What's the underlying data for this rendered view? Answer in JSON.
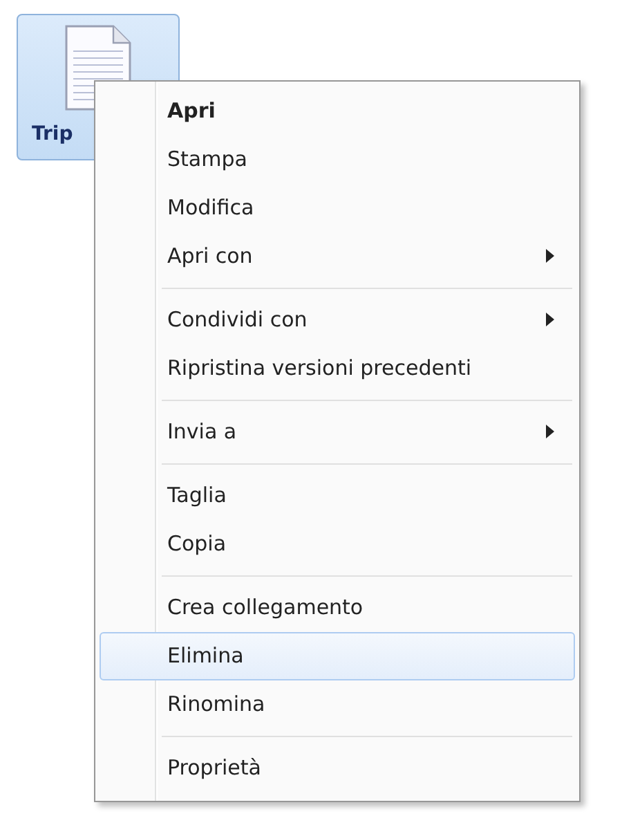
{
  "file_icon": {
    "label": "Trip",
    "selected": true
  },
  "context_menu": {
    "groups": [
      {
        "items": [
          {
            "label": "Apri",
            "default": true,
            "submenu": false,
            "selected": false
          },
          {
            "label": "Stampa",
            "default": false,
            "submenu": false,
            "selected": false
          },
          {
            "label": "Modifica",
            "default": false,
            "submenu": false,
            "selected": false
          },
          {
            "label": "Apri con",
            "default": false,
            "submenu": true,
            "selected": false
          }
        ]
      },
      {
        "items": [
          {
            "label": "Condividi con",
            "default": false,
            "submenu": true,
            "selected": false
          },
          {
            "label": "Ripristina versioni precedenti",
            "default": false,
            "submenu": false,
            "selected": false
          }
        ]
      },
      {
        "items": [
          {
            "label": "Invia a",
            "default": false,
            "submenu": true,
            "selected": false
          }
        ]
      },
      {
        "items": [
          {
            "label": "Taglia",
            "default": false,
            "submenu": false,
            "selected": false
          },
          {
            "label": "Copia",
            "default": false,
            "submenu": false,
            "selected": false
          }
        ]
      },
      {
        "items": [
          {
            "label": "Crea collegamento",
            "default": false,
            "submenu": false,
            "selected": false
          },
          {
            "label": "Elimina",
            "default": false,
            "submenu": false,
            "selected": true
          },
          {
            "label": "Rinomina",
            "default": false,
            "submenu": false,
            "selected": false
          }
        ]
      },
      {
        "items": [
          {
            "label": "Proprietà",
            "default": false,
            "submenu": false,
            "selected": false
          }
        ]
      }
    ]
  }
}
